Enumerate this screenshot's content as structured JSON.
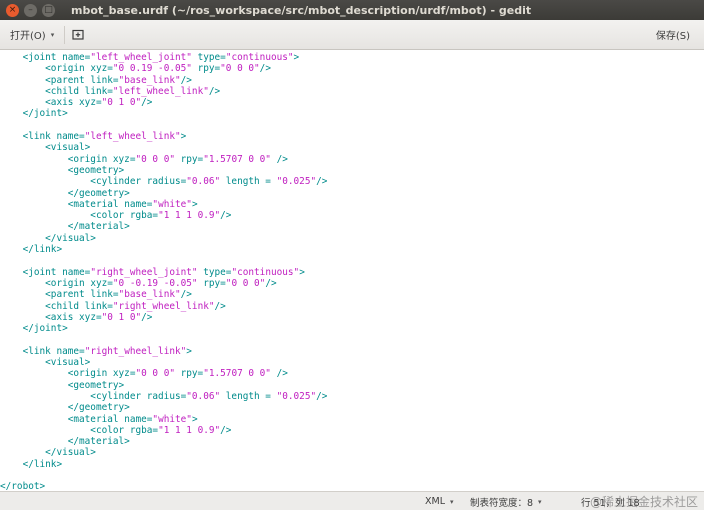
{
  "window": {
    "title": "mbot_base.urdf (~/ros_workspace/src/mbot_description/urdf/mbot) - gedit",
    "close_glyph": "×",
    "minimize_glyph": "–",
    "maximize_glyph": "□"
  },
  "toolbar": {
    "open_label": "打开(O)",
    "open_caret": "▾",
    "new_tab_icon": "new-tab-icon",
    "save_label": "保存(S)"
  },
  "editor": {
    "lines": [
      [
        [
          "tag",
          "    <joint "
        ],
        [
          "attr",
          "name="
        ],
        [
          "str",
          "\"left_wheel_joint\""
        ],
        [
          "attr",
          " type="
        ],
        [
          "str",
          "\"continuous\""
        ],
        [
          "tag",
          ">"
        ]
      ],
      [
        [
          "tag",
          "        <origin "
        ],
        [
          "attr",
          "xyz="
        ],
        [
          "str",
          "\"0 0.19 -0.05\""
        ],
        [
          "attr",
          " rpy="
        ],
        [
          "str",
          "\"0 0 0\""
        ],
        [
          "tag",
          "/>"
        ]
      ],
      [
        [
          "tag",
          "        <parent "
        ],
        [
          "attr",
          "link="
        ],
        [
          "str",
          "\"base_link\""
        ],
        [
          "tag",
          "/>"
        ]
      ],
      [
        [
          "tag",
          "        <child "
        ],
        [
          "attr",
          "link="
        ],
        [
          "str",
          "\"left_wheel_link\""
        ],
        [
          "tag",
          "/>"
        ]
      ],
      [
        [
          "tag",
          "        <axis "
        ],
        [
          "attr",
          "xyz="
        ],
        [
          "str",
          "\"0 1 0\""
        ],
        [
          "tag",
          "/>"
        ]
      ],
      [
        [
          "tag",
          "    </joint>"
        ]
      ],
      [
        [
          "tag",
          ""
        ]
      ],
      [
        [
          "tag",
          "    <link "
        ],
        [
          "attr",
          "name="
        ],
        [
          "str",
          "\"left_wheel_link\""
        ],
        [
          "tag",
          ">"
        ]
      ],
      [
        [
          "tag",
          "        <visual>"
        ]
      ],
      [
        [
          "tag",
          "            <origin "
        ],
        [
          "attr",
          "xyz="
        ],
        [
          "str",
          "\"0 0 0\""
        ],
        [
          "attr",
          " rpy="
        ],
        [
          "str",
          "\"1.5707 0 0\""
        ],
        [
          "tag",
          " />"
        ]
      ],
      [
        [
          "tag",
          "            <geometry>"
        ]
      ],
      [
        [
          "tag",
          "                <cylinder "
        ],
        [
          "attr",
          "radius="
        ],
        [
          "str",
          "\"0.06\""
        ],
        [
          "attr",
          " length = "
        ],
        [
          "str",
          "\"0.025\""
        ],
        [
          "tag",
          "/>"
        ]
      ],
      [
        [
          "tag",
          "            </geometry>"
        ]
      ],
      [
        [
          "tag",
          "            <material "
        ],
        [
          "attr",
          "name="
        ],
        [
          "str",
          "\"white\""
        ],
        [
          "tag",
          ">"
        ]
      ],
      [
        [
          "tag",
          "                <color "
        ],
        [
          "attr",
          "rgba="
        ],
        [
          "str",
          "\"1 1 1 0.9\""
        ],
        [
          "tag",
          "/>"
        ]
      ],
      [
        [
          "tag",
          "            </material>"
        ]
      ],
      [
        [
          "tag",
          "        </visual>"
        ]
      ],
      [
        [
          "tag",
          "    </link>"
        ]
      ],
      [
        [
          "tag",
          ""
        ]
      ],
      [
        [
          "tag",
          "    <joint "
        ],
        [
          "attr",
          "name="
        ],
        [
          "str",
          "\"right_wheel_joint\""
        ],
        [
          "attr",
          " type="
        ],
        [
          "str",
          "\"continuous\""
        ],
        [
          "tag",
          ">"
        ]
      ],
      [
        [
          "tag",
          "        <origin "
        ],
        [
          "attr",
          "xyz="
        ],
        [
          "str",
          "\"0 -0.19 -0.05\""
        ],
        [
          "attr",
          " rpy="
        ],
        [
          "str",
          "\"0 0 0\""
        ],
        [
          "tag",
          "/>"
        ]
      ],
      [
        [
          "tag",
          "        <parent "
        ],
        [
          "attr",
          "link="
        ],
        [
          "str",
          "\"base_link\""
        ],
        [
          "tag",
          "/>"
        ]
      ],
      [
        [
          "tag",
          "        <child "
        ],
        [
          "attr",
          "link="
        ],
        [
          "str",
          "\"right_wheel_link\""
        ],
        [
          "tag",
          "/>"
        ]
      ],
      [
        [
          "tag",
          "        <axis "
        ],
        [
          "attr",
          "xyz="
        ],
        [
          "str",
          "\"0 1 0\""
        ],
        [
          "tag",
          "/>"
        ]
      ],
      [
        [
          "tag",
          "    </joint>"
        ]
      ],
      [
        [
          "tag",
          ""
        ]
      ],
      [
        [
          "tag",
          "    <link "
        ],
        [
          "attr",
          "name="
        ],
        [
          "str",
          "\"right_wheel_link\""
        ],
        [
          "tag",
          ">"
        ]
      ],
      [
        [
          "tag",
          "        <visual>"
        ]
      ],
      [
        [
          "tag",
          "            <origin "
        ],
        [
          "attr",
          "xyz="
        ],
        [
          "str",
          "\"0 0 0\""
        ],
        [
          "attr",
          " rpy="
        ],
        [
          "str",
          "\"1.5707 0 0\""
        ],
        [
          "tag",
          " />"
        ]
      ],
      [
        [
          "tag",
          "            <geometry>"
        ]
      ],
      [
        [
          "tag",
          "                <cylinder "
        ],
        [
          "attr",
          "radius="
        ],
        [
          "str",
          "\"0.06\""
        ],
        [
          "attr",
          " length = "
        ],
        [
          "str",
          "\"0.025\""
        ],
        [
          "tag",
          "/>"
        ]
      ],
      [
        [
          "tag",
          "            </geometry>"
        ]
      ],
      [
        [
          "tag",
          "            <material "
        ],
        [
          "attr",
          "name="
        ],
        [
          "str",
          "\"white\""
        ],
        [
          "tag",
          ">"
        ]
      ],
      [
        [
          "tag",
          "                <color "
        ],
        [
          "attr",
          "rgba="
        ],
        [
          "str",
          "\"1 1 1 0.9\""
        ],
        [
          "tag",
          "/>"
        ]
      ],
      [
        [
          "tag",
          "            </material>"
        ]
      ],
      [
        [
          "tag",
          "        </visual>"
        ]
      ],
      [
        [
          "tag",
          "    </link>"
        ]
      ],
      [
        [
          "tag",
          ""
        ]
      ],
      [
        [
          "tag",
          "</robot>"
        ]
      ]
    ]
  },
  "statusbar": {
    "language": "XML",
    "tab_width": "制表符宽度：8",
    "position": "行 51，列 18",
    "caret": "▾"
  },
  "watermark": "@稀土掘金技术社区",
  "colors": {
    "titlebar": "#3c3b37",
    "tag": "#008b8b",
    "string": "#c020c0",
    "close_button": "#e85b2e"
  }
}
